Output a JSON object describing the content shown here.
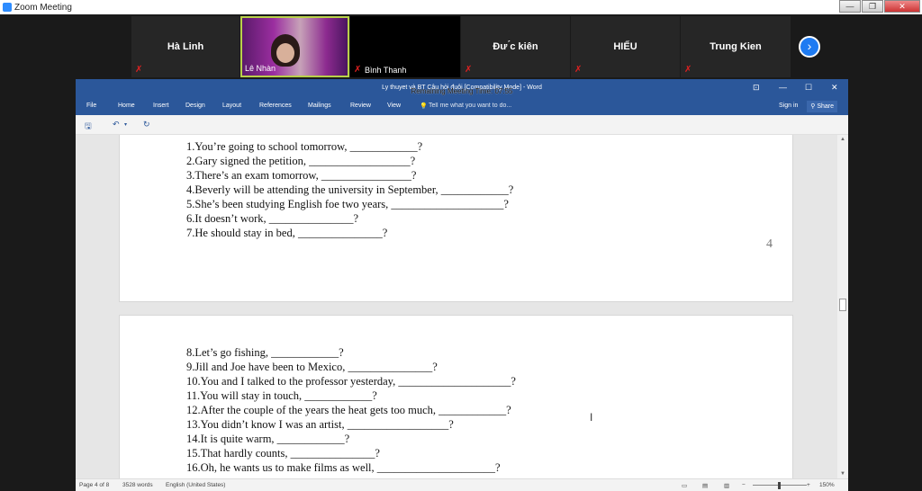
{
  "zoom": {
    "window_title": "Zoom Meeting",
    "window_buttons": {
      "minimize": "—",
      "restore": "❐",
      "close": "✕"
    },
    "participants": [
      {
        "name": "Hà Linh",
        "muted": true,
        "video": false
      },
      {
        "name": "Lê Nhàn",
        "muted": false,
        "video": true
      },
      {
        "name": "Bình Thanh",
        "muted": true,
        "video": false
      },
      {
        "name": "Đư ́c kiên",
        "muted": true,
        "video": false
      },
      {
        "name": "HIẾU",
        "muted": true,
        "video": false
      },
      {
        "name": "Trung Kien",
        "muted": true,
        "video": false
      }
    ],
    "next_page_glyph": "›",
    "muted_glyph": "✗",
    "remaining_time": "Remaining Meeting Time: 07:55"
  },
  "word": {
    "doc_title": "Ly thuyet và BT Câu hỏi đuôi [Compatibility Mode] - Word",
    "title_controls": {
      "restore_ribbon": "⊡",
      "minimize": "—",
      "maximize": "☐",
      "close": "✕"
    },
    "ribbon_tabs": [
      "File",
      "Home",
      "Insert",
      "Design",
      "Layout",
      "References",
      "Mailings",
      "Review",
      "View"
    ],
    "tell_me": "Tell me what you want to do...",
    "sign_in": "Sign in",
    "share": "Share",
    "qat": {
      "save": "🖫",
      "undo": "↶",
      "undo_more": "▾",
      "redo": "↻"
    },
    "page4_lines": [
      "1.You’re going to school tomorrow, ____________?",
      "2.Gary signed the petition, __________________?",
      "3.There’s an exam tomorrow, ________________?",
      "4.Beverly will be attending the university in September, ____________?",
      "5.She’s been studying English foe two years, ____________________?",
      "6.It doesn’t work, _______________?",
      "7.He should stay in bed, _______________?"
    ],
    "page_number": "4",
    "page5_lines": [
      "8.Let’s go fishing, ____________?",
      "9.Jill and Joe have been to Mexico, _______________?",
      "10.You and I talked to the professor yesterday, ____________________?",
      "11.You will stay in touch, ____________?",
      "12.After the couple of the years the heat gets too much, ____________?",
      "13.You didn’t know I was an artist, __________________?",
      "14.It is quite warm, ____________?",
      "15.That hardly counts, _______________?",
      "16.Oh, he wants us to make films as well, _____________________?"
    ],
    "status": {
      "page": "Page 4 of 8",
      "words": "3528 words",
      "language": "English (United States)",
      "zoom": "150%",
      "zoom_minus": "−",
      "zoom_plus": "+"
    }
  },
  "colors": {
    "word_blue": "#2b579a",
    "zoom_blue": "#1e7bf2",
    "mute_red": "#e02020"
  }
}
